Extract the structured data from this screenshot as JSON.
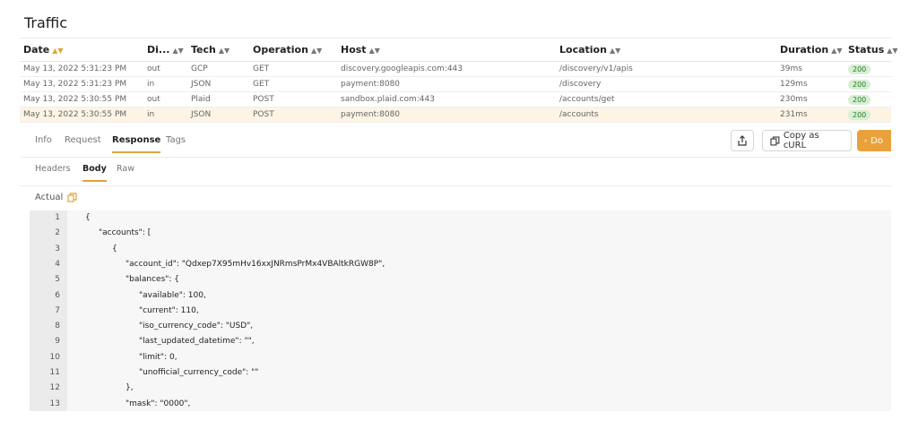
{
  "title": "Traffic",
  "colors": {
    "accent": "#e2a33a",
    "primary_button": "#e9a23b",
    "status_ok_bg": "#d6f0d2",
    "status_ok_text": "#2f7a2f",
    "selected_row": "#fdf4e4"
  },
  "table": {
    "columns": [
      "Date",
      "Di...",
      "Tech",
      "Operation",
      "Host",
      "Location",
      "Duration",
      "Status"
    ],
    "rows": [
      {
        "date": "May 13, 2022 5:31:23 PM",
        "direction": "out",
        "tech": "GCP",
        "operation": "GET",
        "host": "discovery.googleapis.com:443",
        "location": "/discovery/v1/apis",
        "duration": "39ms",
        "status": "200"
      },
      {
        "date": "May 13, 2022 5:31:23 PM",
        "direction": "in",
        "tech": "JSON",
        "operation": "GET",
        "host": "payment:8080",
        "location": "/discovery",
        "duration": "129ms",
        "status": "200"
      },
      {
        "date": "May 13, 2022 5:30:55 PM",
        "direction": "out",
        "tech": "Plaid",
        "operation": "POST",
        "host": "sandbox.plaid.com:443",
        "location": "/accounts/get",
        "duration": "230ms",
        "status": "200"
      },
      {
        "date": "May 13, 2022 5:30:55 PM",
        "direction": "in",
        "tech": "JSON",
        "operation": "POST",
        "host": "payment:8080",
        "location": "/accounts",
        "duration": "231ms",
        "status": "200"
      }
    ]
  },
  "tabs": [
    "Info",
    "Request",
    "Response",
    "Tags"
  ],
  "buttons": {
    "share_icon": "share-icon",
    "copy_curl": "Copy as cURL",
    "download": "Do"
  },
  "subtabs": [
    "Headers",
    "Body",
    "Raw"
  ],
  "actual_label": "Actual",
  "code_lines": [
    {
      "n": "1",
      "text": "{"
    },
    {
      "n": "2",
      "text": "\"accounts\": ["
    },
    {
      "n": "3",
      "text": "{"
    },
    {
      "n": "4",
      "text": "\"account_id\": \"Qdxep7X95mHv16xxJNRmsPrMx4VBAltkRGW8P\","
    },
    {
      "n": "5",
      "text": "\"balances\": {"
    },
    {
      "n": "6",
      "text": "\"available\": 100,"
    },
    {
      "n": "7",
      "text": "\"current\": 110,"
    },
    {
      "n": "8",
      "text": "\"iso_currency_code\": \"USD\","
    },
    {
      "n": "9",
      "text": "\"last_updated_datetime\": \"\","
    },
    {
      "n": "10",
      "text": "\"limit\": 0,"
    },
    {
      "n": "11",
      "text": "\"unofficial_currency_code\": \"\""
    },
    {
      "n": "12",
      "text": "},"
    },
    {
      "n": "13",
      "text": "\"mask\": \"0000\","
    }
  ]
}
